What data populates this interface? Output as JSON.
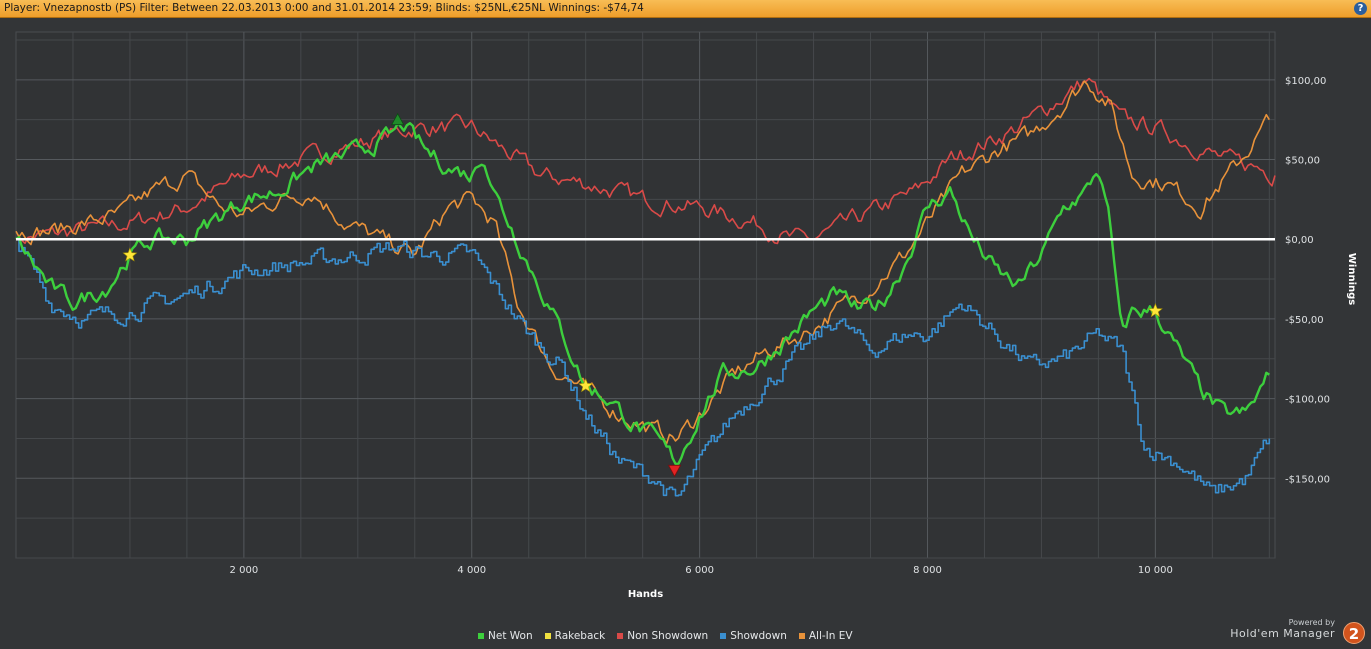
{
  "window": {
    "title": "Player: Vnezapnostb (PS) Filter: Between 22.03.2013 0:00 and 31.01.2014 23:59; Blinds: $25NL,€25NL Winnings: -$74,74",
    "help_icon": "question-mark-icon"
  },
  "branding": {
    "powered_by": "Powered by",
    "product": "Hold'em Manager",
    "logo_text": "2"
  },
  "chart_data": {
    "type": "line",
    "xlabel": "Hands",
    "ylabel": "Winnings",
    "x_ticks": [
      2000,
      4000,
      6000,
      8000,
      10000
    ],
    "x_tick_labels": [
      "2 000",
      "4 000",
      "6 000",
      "8 000",
      "10 000"
    ],
    "y_ticks": [
      -150,
      -100,
      -50,
      0,
      50,
      100
    ],
    "y_tick_labels": [
      "-$150,00",
      "-$100,00",
      "-$50,00",
      "$0,00",
      "$50,00",
      "$100,00"
    ],
    "xlim": [
      0,
      11050
    ],
    "ylim": [
      -200,
      130
    ],
    "grid": true,
    "legend_position": "bottom-center",
    "series": [
      {
        "name": "Net Won",
        "color": "#3dcf3d",
        "x": [
          0,
          300,
          500,
          800,
          1000,
          1200,
          1500,
          1800,
          2000,
          2300,
          2600,
          3000,
          3300,
          3400,
          3600,
          3800,
          4000,
          4100,
          4200,
          4400,
          4600,
          4800,
          5000,
          5200,
          5400,
          5600,
          5800,
          6000,
          6200,
          6500,
          6800,
          7000,
          7200,
          7400,
          7600,
          7800,
          8000,
          8200,
          8400,
          8600,
          8800,
          9000,
          9200,
          9400,
          9500,
          9600,
          9700,
          9800,
          10000,
          10200,
          10400,
          10600,
          10800,
          11000
        ],
        "y": [
          0,
          -30,
          -40,
          -30,
          -10,
          0,
          0,
          15,
          25,
          30,
          45,
          55,
          65,
          72,
          55,
          45,
          40,
          55,
          30,
          0,
          -30,
          -60,
          -92,
          -100,
          -115,
          -125,
          -140,
          -110,
          -85,
          -80,
          -60,
          -45,
          -35,
          -45,
          -40,
          -15,
          20,
          30,
          0,
          -20,
          -30,
          -10,
          20,
          30,
          45,
          10,
          -60,
          -45,
          -45,
          -70,
          -95,
          -110,
          -110,
          -85
        ]
      },
      {
        "name": "Rakeback",
        "color": "#f0e040",
        "x": [
          0,
          11050
        ],
        "y": [
          0,
          0
        ]
      },
      {
        "name": "Non Showdown",
        "color": "#d94a48",
        "x": [
          0,
          500,
          1000,
          1500,
          2000,
          2500,
          3000,
          3500,
          4000,
          4300,
          4600,
          5000,
          5500,
          6000,
          6500,
          6800,
          7000,
          7300,
          7600,
          7900,
          8200,
          8500,
          8800,
          9100,
          9400,
          9700,
          10000,
          10300,
          10600,
          10900,
          11050
        ],
        "y": [
          0,
          5,
          10,
          20,
          40,
          50,
          60,
          70,
          70,
          55,
          40,
          35,
          25,
          20,
          10,
          0,
          0,
          10,
          20,
          30,
          50,
          60,
          70,
          85,
          100,
          75,
          70,
          60,
          50,
          45,
          40
        ]
      },
      {
        "name": "Showdown",
        "color": "#3a8fd0",
        "x": [
          0,
          300,
          600,
          1000,
          1500,
          2000,
          2500,
          3000,
          3300,
          3600,
          4000,
          4300,
          4500,
          4800,
          5000,
          5300,
          5600,
          5800,
          6000,
          6300,
          6600,
          6900,
          7200,
          7500,
          7800,
          8000,
          8300,
          8600,
          8900,
          9200,
          9500,
          9700,
          9900,
          10200,
          10500,
          10800,
          11000
        ],
        "y": [
          0,
          -40,
          -50,
          -45,
          -35,
          -20,
          -15,
          -10,
          -5,
          -10,
          -10,
          -40,
          -60,
          -80,
          -110,
          -140,
          -150,
          -165,
          -140,
          -110,
          -90,
          -70,
          -50,
          -70,
          -60,
          -60,
          -40,
          -60,
          -80,
          -75,
          -60,
          -70,
          -130,
          -140,
          -160,
          -150,
          -125
        ]
      },
      {
        "name": "All-In EV",
        "color": "#e8923a",
        "x": [
          0,
          300,
          600,
          900,
          1200,
          1500,
          1800,
          2000,
          2300,
          2600,
          2900,
          3200,
          3500,
          3800,
          4000,
          4200,
          4400,
          4700,
          5000,
          5300,
          5600,
          5800,
          6000,
          6300,
          6600,
          6900,
          7200,
          7500,
          7800,
          8000,
          8300,
          8600,
          8900,
          9200,
          9400,
          9600,
          9800,
          10100,
          10400,
          10700,
          11000
        ],
        "y": [
          5,
          5,
          10,
          15,
          30,
          40,
          20,
          15,
          25,
          30,
          10,
          0,
          -10,
          20,
          25,
          10,
          -40,
          -80,
          -95,
          -110,
          -120,
          -125,
          -110,
          -85,
          -70,
          -60,
          -45,
          -30,
          -10,
          10,
          40,
          55,
          65,
          85,
          100,
          85,
          40,
          35,
          20,
          45,
          75
        ]
      }
    ],
    "markers": [
      {
        "type": "star",
        "x": 1000,
        "y": -10,
        "color": "#ffe63a"
      },
      {
        "type": "star",
        "x": 5000,
        "y": -92,
        "color": "#ffe63a"
      },
      {
        "type": "star",
        "x": 10000,
        "y": -45,
        "color": "#ffe63a"
      },
      {
        "type": "peak",
        "x": 3350,
        "y": 75,
        "color": "#1f8a2a"
      },
      {
        "type": "trough",
        "x": 5780,
        "y": -145,
        "color": "#e22323"
      }
    ],
    "zero_line_color": "#ffffff"
  }
}
